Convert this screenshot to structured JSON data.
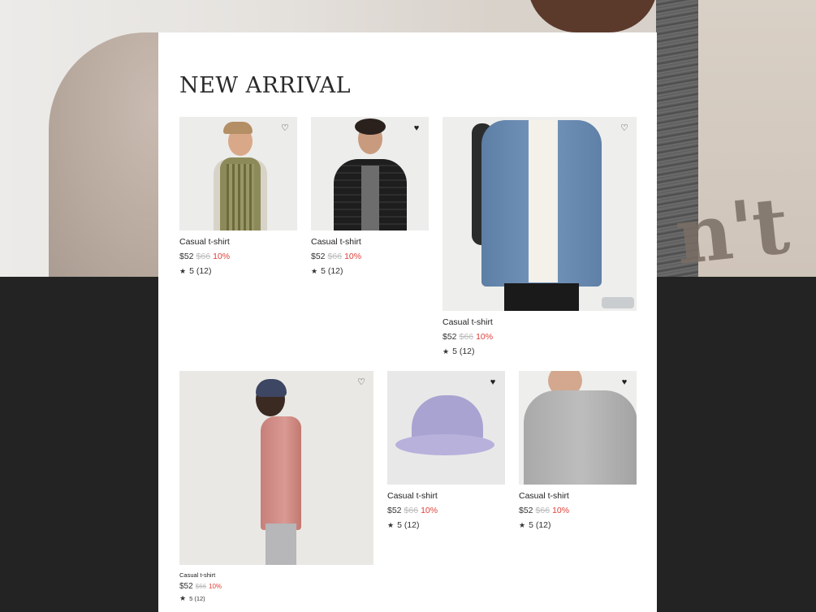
{
  "section": {
    "title": "NEW ARRIVAL"
  },
  "colors": {
    "discount": "#e0413a",
    "old_price": "#bbbbbb",
    "text": "#222222"
  },
  "products": [
    {
      "name": "Casual t-shirt",
      "price": "$52",
      "old_price": "$66",
      "discount": "10%",
      "star": "★",
      "rating": "5 (12)",
      "wishlisted": false,
      "heart": "♡"
    },
    {
      "name": "Casual t-shirt",
      "price": "$52",
      "old_price": "$66",
      "discount": "10%",
      "star": "★",
      "rating": "5 (12)",
      "wishlisted": true,
      "heart": "♥"
    },
    {
      "name": "Casual t-shirt",
      "price": "$52",
      "old_price": "$66",
      "discount": "10%",
      "star": "★",
      "rating": "5 (12)",
      "wishlisted": false,
      "heart": "♡"
    },
    {
      "name": "Casual t-shirt",
      "price": "$52",
      "old_price": "$66",
      "discount": "10%",
      "star": "★",
      "rating": "5 (12)",
      "wishlisted": false,
      "heart": "♡"
    },
    {
      "name": "Casual t-shirt",
      "price": "$52",
      "old_price": "$66",
      "discount": "10%",
      "star": "★",
      "rating": "5 (12)",
      "wishlisted": true,
      "heart": "♥"
    },
    {
      "name": "Casual t-shirt",
      "price": "$52",
      "old_price": "$66",
      "discount": "10%",
      "star": "★",
      "rating": "5 (12)",
      "wishlisted": true,
      "heart": "♥"
    }
  ]
}
